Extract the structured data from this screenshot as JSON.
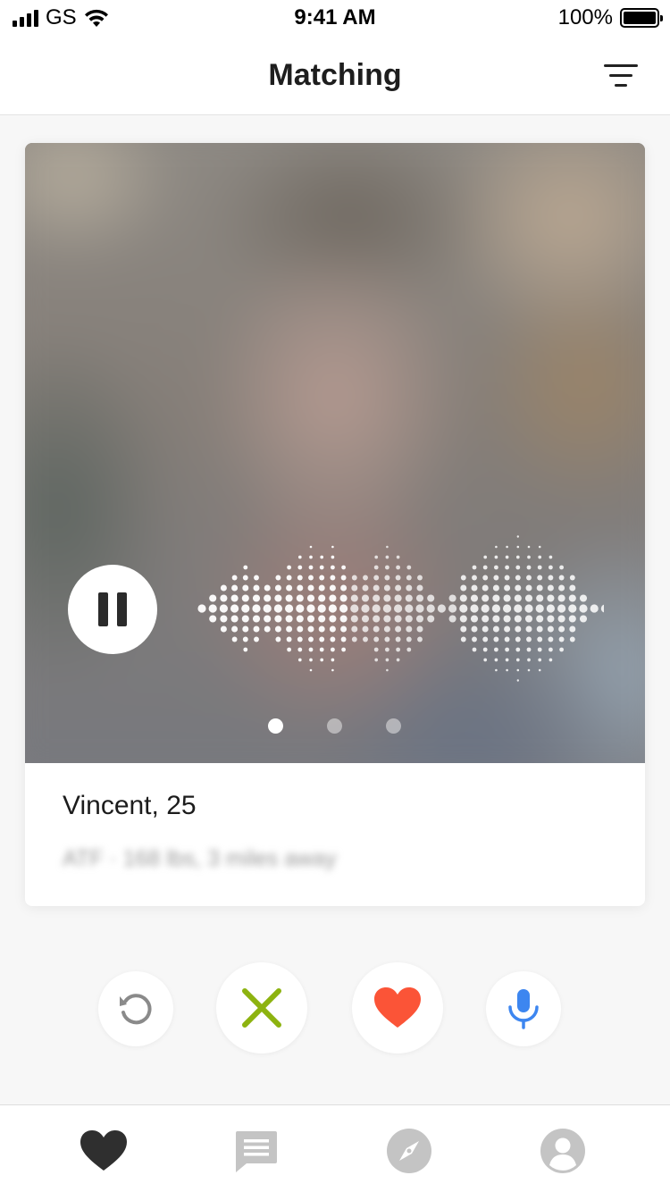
{
  "status_bar": {
    "carrier": "GS",
    "time": "9:41 AM",
    "battery": "100%",
    "signal_icon": "cellular-signal-icon",
    "wifi_icon": "wifi-icon",
    "battery_icon": "battery-icon"
  },
  "header": {
    "title": "Matching",
    "filter_icon": "filter-icon"
  },
  "profile": {
    "name_age": "Vincent, 25",
    "details_blurred": "ATF · 168 lbs, 3 miles away",
    "photo_blurred": true,
    "pause_icon": "pause-icon",
    "audio_playing": true,
    "photo_count": 3,
    "active_photo_index": 0
  },
  "actions": [
    {
      "name": "rewind",
      "icon": "rewind-icon",
      "color": "#8a8a8a"
    },
    {
      "name": "dislike",
      "icon": "x-icon",
      "color": "#8db310"
    },
    {
      "name": "like",
      "icon": "heart-icon",
      "color": "#fb5437"
    },
    {
      "name": "voice",
      "icon": "microphone-icon",
      "color": "#3d86f0"
    }
  ],
  "tabs": [
    {
      "name": "matching",
      "icon": "heart-icon",
      "active": true
    },
    {
      "name": "messages",
      "icon": "chat-icon",
      "active": false
    },
    {
      "name": "discover",
      "icon": "compass-icon",
      "active": false
    },
    {
      "name": "profile",
      "icon": "profile-icon",
      "active": false
    }
  ],
  "colors": {
    "active_tab": "#2f2f2f",
    "inactive_tab": "#c4c4c4",
    "background": "#f7f7f7"
  }
}
